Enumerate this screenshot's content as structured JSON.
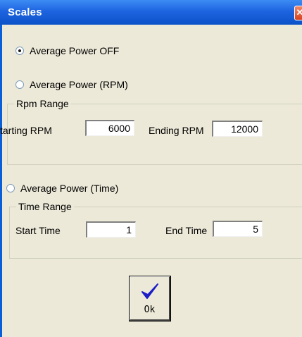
{
  "window": {
    "title": "Scales",
    "close_glyph": "✕"
  },
  "options": [
    {
      "label": "Average Power OFF",
      "selected": true
    },
    {
      "label": "Average Power (RPM)",
      "selected": false
    },
    {
      "label": "Average Power (Time)",
      "selected": false
    }
  ],
  "rpm_range": {
    "legend": "Rpm Range",
    "start_label": "tarting RPM",
    "start_value": "6000",
    "end_label": "Ending RPM",
    "end_value": "12000"
  },
  "time_range": {
    "legend": "Time Range",
    "start_label": "Start Time",
    "start_value": "1",
    "end_label": "End Time",
    "end_value": "5"
  },
  "ok_button": {
    "label": "Ok",
    "icon": "checkmark-icon"
  }
}
